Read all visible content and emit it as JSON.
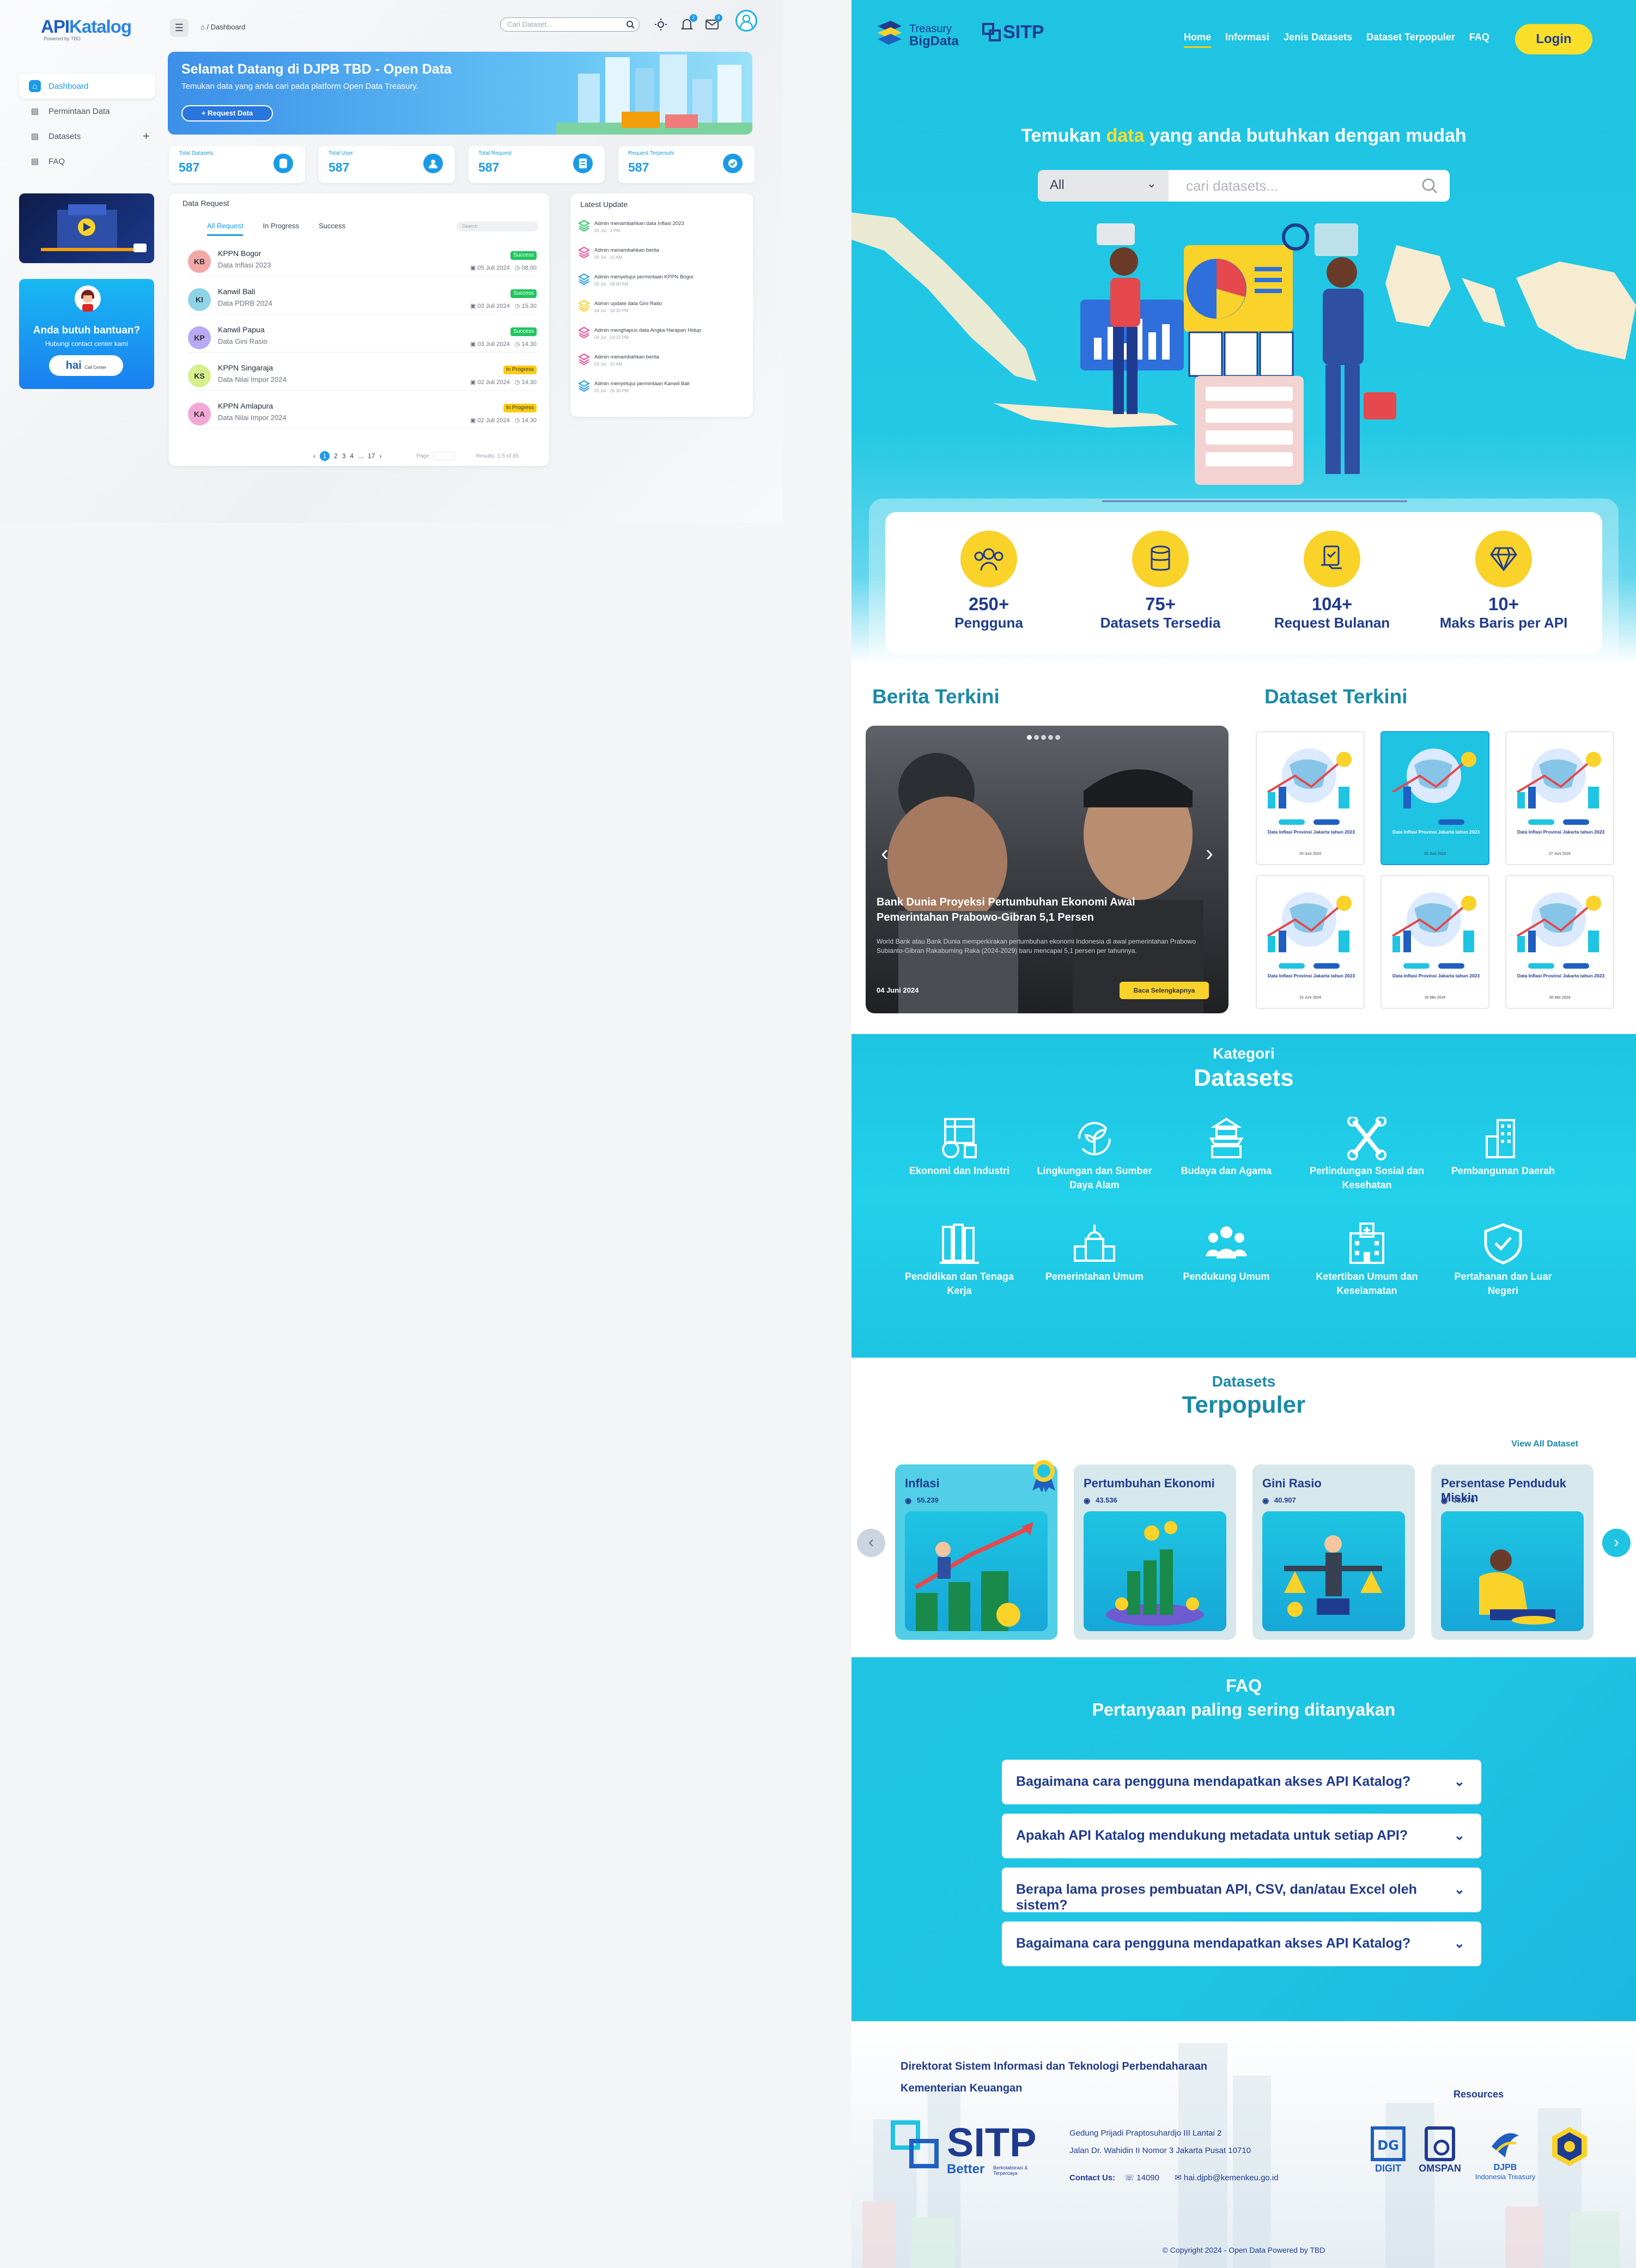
{
  "dashboard": {
    "logo": {
      "api": "API",
      "katalog": "Katalog",
      "sub": "Powered by TBD"
    },
    "breadcrumb": "/ Dashboard",
    "search_placeholder": "Cari Dataset...",
    "notif_badge": "2",
    "mail_badge": "4",
    "sidebar": [
      {
        "label": "Dashboard",
        "icon": "home-icon",
        "active": true
      },
      {
        "label": "Permintaan Data",
        "icon": "document-icon",
        "active": false
      },
      {
        "label": "Datasets",
        "icon": "database-icon",
        "active": false
      },
      {
        "label": "FAQ",
        "icon": "help-icon",
        "active": false
      }
    ],
    "help": {
      "title": "Anda butuh bantuan?",
      "sub": "Hubungi contact center kami",
      "cc_main": "hai",
      "cc_sub": "Call Center"
    },
    "banner": {
      "title": "Selamat Datang di DJPB TBD - Open Data",
      "subtitle": "Temukan data yang anda cari pada platform Open Data Treasury.",
      "button": "+ Request Data"
    },
    "stats": [
      {
        "label": "Total Datasets",
        "value": "587",
        "icon": "database-icon"
      },
      {
        "label": "Total User",
        "value": "587",
        "icon": "users-icon"
      },
      {
        "label": "Total Request",
        "value": "587",
        "icon": "request-icon"
      },
      {
        "label": "Request Terpenuhi",
        "value": "587",
        "icon": "check-icon"
      }
    ],
    "data_request": {
      "title": "Data Request",
      "tabs": [
        "All Request",
        "In Progress",
        "Success"
      ],
      "search_placeholder": "Search",
      "rows": [
        {
          "initials": "KB",
          "name": "KPPN Bogor",
          "desc": "Data Inflasi 2023",
          "date": "05 Juli 2024",
          "time": "08.00",
          "status": "Success",
          "color": "#f3a8a8"
        },
        {
          "initials": "KI",
          "name": "Kanwil Bali",
          "desc": "Data PDRB 2024",
          "date": "03 Juli 2024",
          "time": "15.30",
          "status": "Success",
          "color": "#8fd3e6"
        },
        {
          "initials": "KP",
          "name": "Kanwil Papua",
          "desc": "Data Gini Rasio",
          "date": "03 Juli 2024",
          "time": "14.30",
          "status": "Success",
          "color": "#b9a8f3"
        },
        {
          "initials": "KS",
          "name": "KPPN Singaraja",
          "desc": "Data Nilai Impor 2024",
          "date": "02 Juli 2024",
          "time": "14.30",
          "status": "In Progress",
          "color": "#d7ef8e"
        },
        {
          "initials": "KA",
          "name": "KPPN Amlapura",
          "desc": "Data Nilai Impor 2024",
          "date": "02 Juli 2024",
          "time": "14.30",
          "status": "In Progress",
          "color": "#f3a8d6"
        }
      ],
      "pager": {
        "prev": "‹",
        "pages": [
          "1",
          "2",
          "3",
          "4",
          "...",
          "17"
        ],
        "next": "›",
        "page_label": "Page",
        "results": "Results: 1-5 of 85"
      }
    },
    "latest_update": {
      "title": "Latest Update",
      "items": [
        {
          "text": "Admin menambahkan data Inflasi 2023",
          "time": "05 Jul · 2 PM",
          "color": "#22c55e"
        },
        {
          "text": "Admin menambahkan berita",
          "time": "05 Jul · 10 AM",
          "color": "#ec4899"
        },
        {
          "text": "Admin menyetujui permintaan KPPN Bogor",
          "time": "05 Jul · 08:00 AM",
          "color": "#1a9be6"
        },
        {
          "text": "Admin update data Gini Ratio",
          "time": "04 Jul · 18:20 PM",
          "color": "#facc15"
        },
        {
          "text": "Admin menghapus data Angka Harapan Hidup",
          "time": "04 Jul · 14:22 PM",
          "color": "#ec4899"
        },
        {
          "text": "Admin menambahkan berita",
          "time": "03 Jul · 10 AM",
          "color": "#ec4899"
        },
        {
          "text": "Admin menyetujui permintaan Kanwil Bali",
          "time": "01 Jul · 16.30 PM",
          "color": "#1a9be6"
        }
      ]
    }
  },
  "landing": {
    "brand": {
      "treasury": "Treasury",
      "bigdata": "BigData",
      "sitp": "SITP"
    },
    "nav": [
      "Home",
      "Informasi",
      "Jenis Datasets",
      "Dataset Terpopuler",
      "FAQ"
    ],
    "login": "Login",
    "hero": {
      "q_before": "Temukan ",
      "q_hl": "data",
      "q_after": " yang anda butuhkan dengan mudah",
      "select": "All",
      "placeholder": "cari datasets..."
    },
    "stats": [
      {
        "value": "250+",
        "label": "Pengguna",
        "icon": "users-icon"
      },
      {
        "value": "75+",
        "label": "Datasets Tersedia",
        "icon": "database-icon"
      },
      {
        "value": "104+",
        "label": "Request Bulanan",
        "icon": "request-icon"
      },
      {
        "value": "10+",
        "label": "Maks Baris per API",
        "icon": "diamond-icon"
      }
    ],
    "berita": {
      "heading": "Berita Terkini",
      "headline": "Bank Dunia Proyeksi Pertumbuhan Ekonomi Awal Pemerintahan Prabowo-Gibran 5,1 Persen",
      "excerpt": "World Bank atau Bank Dunia memperkirakan pertumbuhan ekonomi Indonesia di awal pemerintahan Prabowo Subianto-Gibran Rakabuming Raka (2024-2029) baru mencapai 5,1 persen per tahunnya.",
      "date": "04 Juni 2024",
      "button": "Baca Selengkapnya"
    },
    "dataset_terkini": {
      "heading": "Dataset Terkini",
      "cards": [
        {
          "title": "Data Inflasi Provinsi Jakarta tahun 2023",
          "date": "20 Juni 2024"
        },
        {
          "title": "Data Inflasi Provinsi Jakarta tahun 2023",
          "date": "20 Juni 2024"
        },
        {
          "title": "Data Inflasi Provinsi Jakarta tahun 2023",
          "date": "27 Juni 2024"
        },
        {
          "title": "Data Inflasi Provinsi Jakarta tahun 2023",
          "date": "15 Juni 2024"
        },
        {
          "title": "Data Inflasi Provinsi Jakarta tahun 2023",
          "date": "30 Mei 2024"
        },
        {
          "title": "Data Inflasi Provinsi Jakarta tahun 2023",
          "date": "30 Mei 2024"
        }
      ]
    },
    "kategori": {
      "h1": "Kategori",
      "h2": "Datasets",
      "items": [
        {
          "label": "Ekonomi dan Industri",
          "icon": "economy-icon"
        },
        {
          "label": "Lingkungan dan Sumber Daya Alam",
          "icon": "environment-icon"
        },
        {
          "label": "Budaya dan Agama",
          "icon": "temple-icon"
        },
        {
          "label": "Perlindungan Sosial dan Kesehatan",
          "icon": "social-icon"
        },
        {
          "label": "Pembangunan Daerah",
          "icon": "building-icon"
        },
        {
          "label": "Pendidikan dan Tenaga Kerja",
          "icon": "education-icon"
        },
        {
          "label": "Pemerintahan Umum",
          "icon": "government-icon"
        },
        {
          "label": "Pendukung Umum",
          "icon": "people-icon"
        },
        {
          "label": "Ketertiban Umum dan Keselamatan",
          "icon": "hospital-icon"
        },
        {
          "label": "Pertahanan dan Luar Negeri",
          "icon": "shield-icon"
        }
      ]
    },
    "terpopuler": {
      "h1": "Datasets",
      "h2": "Terpopuler",
      "view_all": "View All Dataset",
      "items": [
        {
          "title": "Inflasi",
          "views": "55.239"
        },
        {
          "title": "Pertumbuhan Ekonomi",
          "views": "43.536"
        },
        {
          "title": "Gini Rasio",
          "views": "40.907"
        },
        {
          "title": "Persentase Penduduk Miskin",
          "views": "38.576"
        }
      ]
    },
    "faq": {
      "h1": "FAQ",
      "h2": "Pertanyaan paling sering ditanyakan",
      "items": [
        "Bagaimana cara pengguna mendapatkan akses API Katalog?",
        "Apakah API Katalog mendukung metadata untuk setiap API?",
        "Berapa lama proses pembuatan API, CSV, dan/atau Excel oleh sistem?",
        "Bagaimana cara pengguna mendapatkan akses API Katalog?"
      ]
    },
    "footer": {
      "org1": "Direktorat Sistem Informasi dan Teknologi Perbendaharaan",
      "org2": "Kementerian Keuangan",
      "sitp": "SITP",
      "better": "Better",
      "better_sub": "Berkolaborasi & Terpercaya",
      "addr1": "Gedung Prijadi Praptosuhardjo III Lantai 2",
      "addr2": "Jalan Dr. Wahidin II Nomor 3 Jakarta Pusat 10710",
      "contact_label": "Contact Us:",
      "phone": "14090",
      "email": "hai.djpb@kemenkeu.go.id",
      "resources": "Resources",
      "res_logos": [
        {
          "name": "DIGIT"
        },
        {
          "name": "OMSPAN"
        },
        {
          "name": "DJPB",
          "sub": "Indonesia Treasury"
        }
      ],
      "copyright": "© Copyright 2024 - Open Data Powered by TBD"
    }
  }
}
